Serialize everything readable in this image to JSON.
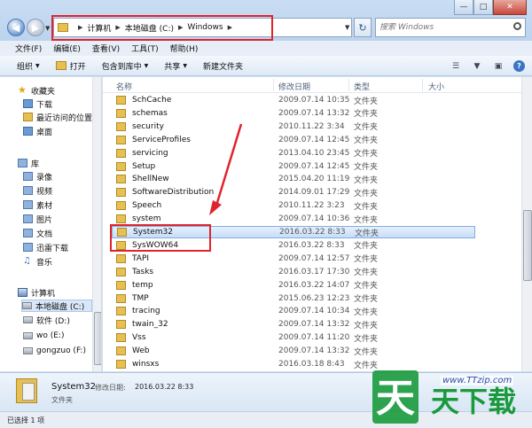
{
  "address": {
    "crumbs": [
      "计算机",
      "本地磁盘 (C:)",
      "Windows"
    ],
    "search_placeholder": "搜索 Windows"
  },
  "menu": [
    "文件(F)",
    "编辑(E)",
    "查看(V)",
    "工具(T)",
    "帮助(H)"
  ],
  "toolbar": {
    "organize": "组织",
    "open": "打开",
    "include": "包含到库中",
    "share": "共享",
    "new_folder": "新建文件夹"
  },
  "nav": {
    "favorites": "收藏夹",
    "downloads": "下载",
    "recent": "最近访问的位置",
    "desktop": "桌面",
    "libraries": "库",
    "lib_items": [
      "录像",
      "视频",
      "素材",
      "图片",
      "文档",
      "迅雷下载",
      "音乐"
    ],
    "computer": "计算机",
    "drives": [
      "本地磁盘 (C:)",
      "软件 (D:)",
      "wo (E:)",
      "gongzuo (F:)"
    ]
  },
  "columns": {
    "name": "名称",
    "modified": "修改日期",
    "type": "类型",
    "size": "大小"
  },
  "files": [
    {
      "name": "SchCache",
      "date": "2009.07.14 10:35",
      "type": "文件夹"
    },
    {
      "name": "schemas",
      "date": "2009.07.14 13:32",
      "type": "文件夹"
    },
    {
      "name": "security",
      "date": "2010.11.22 3:34",
      "type": "文件夹"
    },
    {
      "name": "ServiceProfiles",
      "date": "2009.07.14 12:45",
      "type": "文件夹"
    },
    {
      "name": "servicing",
      "date": "2013.04.10 23:45",
      "type": "文件夹"
    },
    {
      "name": "Setup",
      "date": "2009.07.14 12:45",
      "type": "文件夹"
    },
    {
      "name": "ShellNew",
      "date": "2015.04.20 11:19",
      "type": "文件夹"
    },
    {
      "name": "SoftwareDistribution",
      "date": "2014.09.01 17:29",
      "type": "文件夹"
    },
    {
      "name": "Speech",
      "date": "2010.11.22 3:23",
      "type": "文件夹"
    },
    {
      "name": "system",
      "date": "2009.07.14 10:36",
      "type": "文件夹"
    },
    {
      "name": "System32",
      "date": "2016.03.22 8:33",
      "type": "文件夹"
    },
    {
      "name": "SysWOW64",
      "date": "2016.03.22 8:33",
      "type": "文件夹"
    },
    {
      "name": "TAPI",
      "date": "2009.07.14 12:57",
      "type": "文件夹"
    },
    {
      "name": "Tasks",
      "date": "2016.03.17 17:30",
      "type": "文件夹"
    },
    {
      "name": "temp",
      "date": "2016.03.22 14:07",
      "type": "文件夹"
    },
    {
      "name": "TMP",
      "date": "2015.06.23 12:23",
      "type": "文件夹"
    },
    {
      "name": "tracing",
      "date": "2009.07.14 10:34",
      "type": "文件夹"
    },
    {
      "name": "twain_32",
      "date": "2009.07.14 13:32",
      "type": "文件夹"
    },
    {
      "name": "Vss",
      "date": "2009.07.14 11:20",
      "type": "文件夹"
    },
    {
      "name": "Web",
      "date": "2009.07.14 13:32",
      "type": "文件夹"
    },
    {
      "name": "winsxs",
      "date": "2016.03.18 8:43",
      "type": "文件夹"
    }
  ],
  "details": {
    "name": "System32",
    "modified_label": "修改日期:",
    "modified_value": "2016.03.22 8:33",
    "type": "文件夹"
  },
  "status": "已选择 1 项",
  "watermark": {
    "url": "www.TTzip.com",
    "logo_text": "天天下载"
  },
  "colors": {
    "highlight_red": "#e0232c",
    "folder_yellow": "#e6c050",
    "selection_blue": "#c7ddf8",
    "watermark_green": "#1a9a3c"
  }
}
